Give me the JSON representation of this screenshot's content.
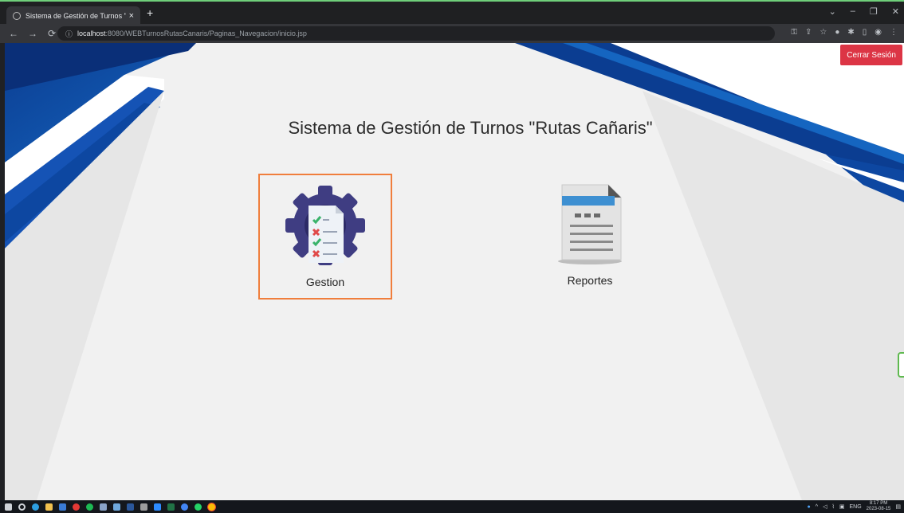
{
  "browser": {
    "tab_title": "Sistema de Gestión de Turnos \"R",
    "tab_close": "×",
    "new_tab": "+",
    "url_host": "localhost",
    "url_path": ":8080/WEBTurnosRutasCanaris/Paginas_Navegacion/inicio.jsp",
    "window_controls": [
      "⌄",
      "–",
      "❐",
      "✕"
    ]
  },
  "page": {
    "title": "Sistema de Gestión de Turnos \"Rutas Cañaris\"",
    "logout_label": "Cerrar Sesión",
    "cards": [
      {
        "label": "Gestion",
        "selected": true
      },
      {
        "label": "Reportes",
        "selected": false
      }
    ]
  },
  "taskbar": {
    "language": "ENG",
    "time": "8:17 PM",
    "date": "2023-08-15"
  },
  "colors": {
    "accent_blue": "#0d47a1",
    "logout_red": "#dc3545",
    "selection_orange": "#f07e3c"
  }
}
